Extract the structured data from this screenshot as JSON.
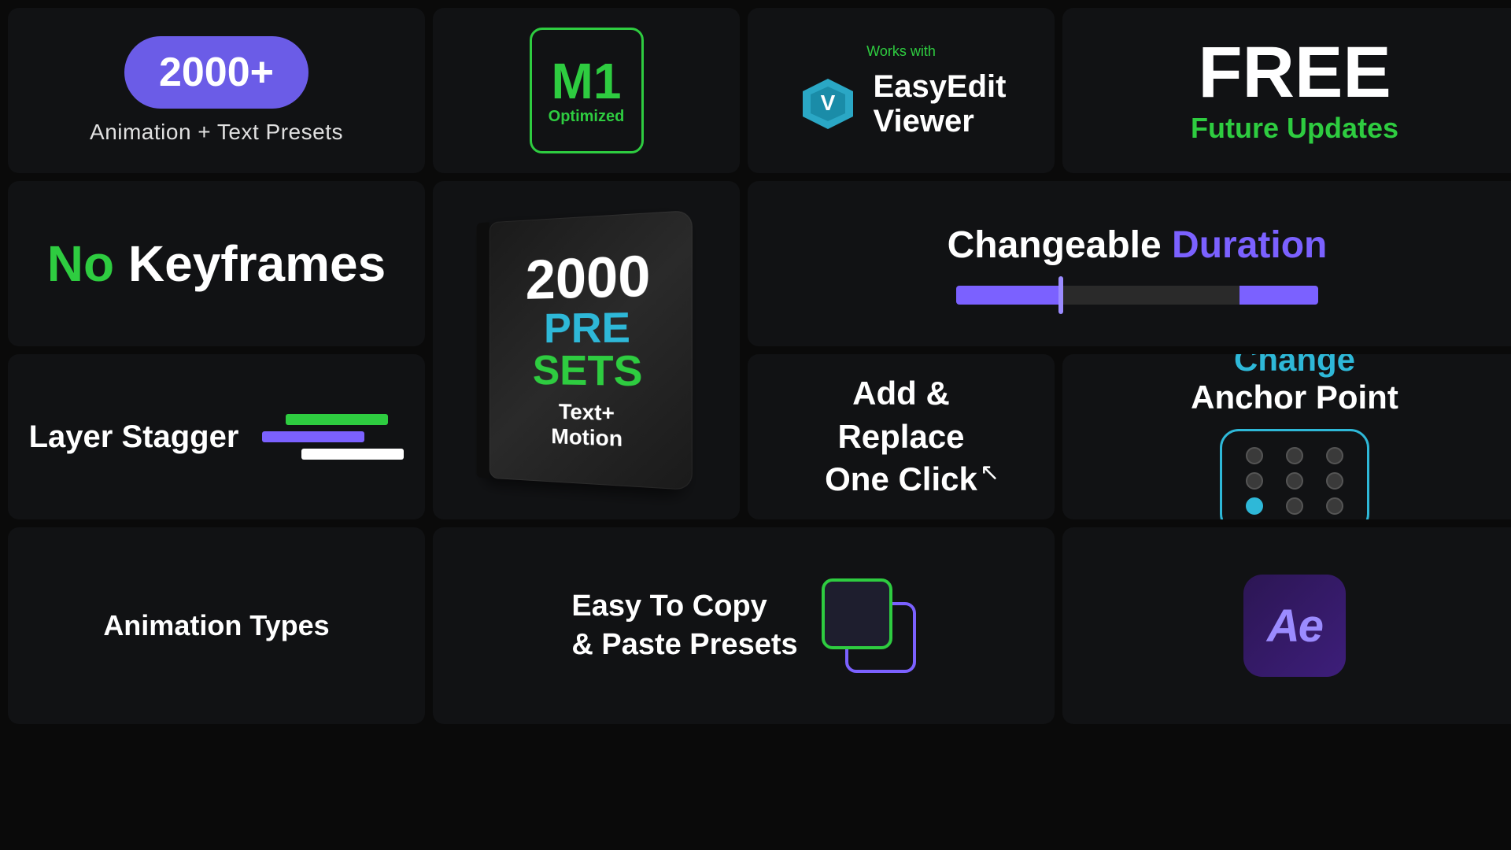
{
  "cell1": {
    "badge": "2000+",
    "label": "Animation + Text Presets"
  },
  "cell2": {
    "m1": "M1",
    "optimized": "Optimized"
  },
  "cell3": {
    "works_with": "Works with",
    "name": "EasyEdit\nViewer"
  },
  "cell4": {
    "free": "FREE",
    "updates": "Future Updates"
  },
  "cell5": {
    "no": "No",
    "label": "Keyframes"
  },
  "cell6": {
    "number": "2000",
    "pre": "PRE",
    "sets": "SETS",
    "subtitle": "Text+\nMotion"
  },
  "cell7": {
    "changeable": "Changeable",
    "duration": "Duration"
  },
  "cell8": {
    "label": "Layer Stagger"
  },
  "cell9": {
    "line1": "Add &",
    "line2": "Replace",
    "line3": "One Click"
  },
  "cell10": {
    "change": "Change",
    "anchor_point": "Anchor Point",
    "dots": [
      false,
      false,
      false,
      false,
      false,
      false,
      true,
      false,
      false
    ]
  },
  "cell11": {
    "label": "Animation Types"
  },
  "cell12": {
    "line1": "Easy To Copy",
    "line2": "& Paste Presets"
  },
  "cell13": {
    "ae": "Ae"
  }
}
